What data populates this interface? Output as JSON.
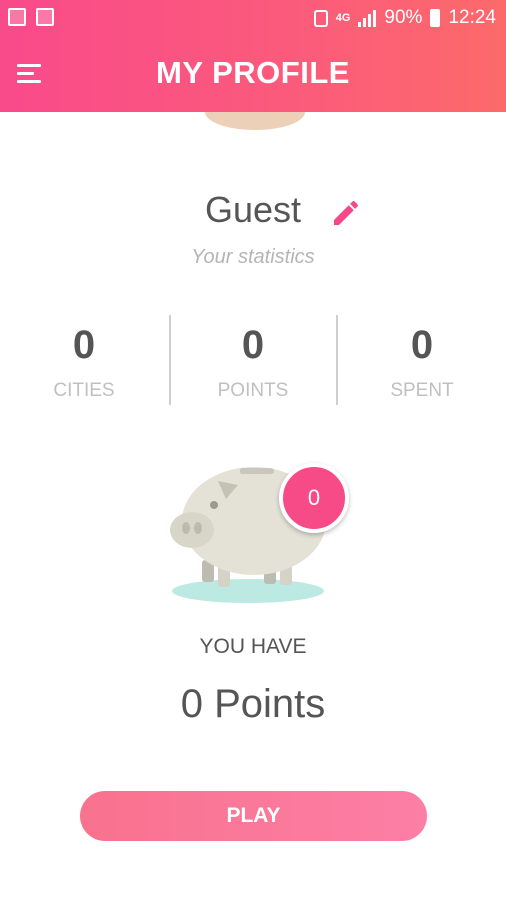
{
  "status_bar": {
    "network": "4G",
    "battery": "90%",
    "time": "12:24"
  },
  "header": {
    "title": "MY PROFILE",
    "menu_icon": "hamburger-menu-icon"
  },
  "profile": {
    "name": "Guest",
    "edit_icon": "pencil-icon",
    "subtitle": "Your statistics"
  },
  "stats": [
    {
      "value": "0",
      "label": "CITIES"
    },
    {
      "value": "0",
      "label": "POINTS"
    },
    {
      "value": "0",
      "label": "SPENT"
    }
  ],
  "piggy_bank": {
    "badge_count": "0",
    "you_have_label": "YOU HAVE",
    "points_text": "0 Points"
  },
  "actions": {
    "play_label": "PLAY"
  },
  "colors": {
    "accent_pink": "#f94a8a",
    "accent_coral": "#fc6a6a",
    "text_dark": "#555555",
    "text_muted": "#c0c0c0"
  }
}
